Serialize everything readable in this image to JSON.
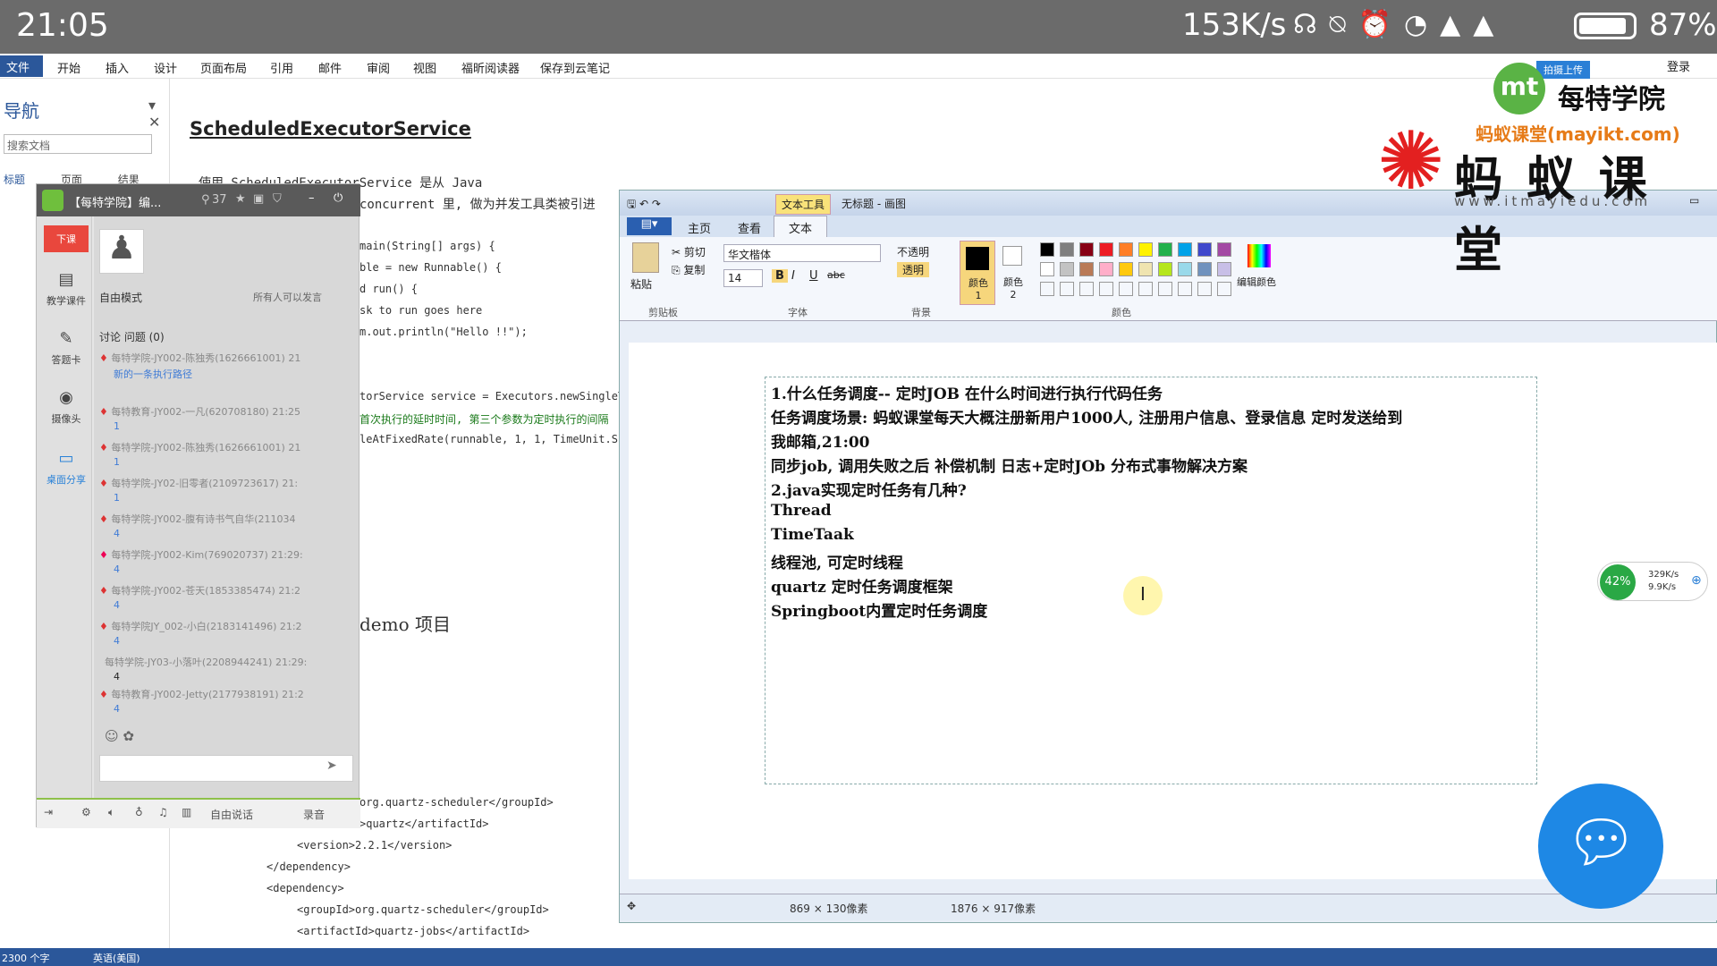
{
  "statusbar": {
    "time": "21:05",
    "speed": "153K/s",
    "battery": "87%"
  },
  "word": {
    "menu": [
      "文件",
      "开始",
      "插入",
      "设计",
      "页面布局",
      "引用",
      "邮件",
      "审阅",
      "视图",
      "福昕阅读器",
      "保存到云笔记"
    ],
    "login": "登录",
    "nav_title": "导航",
    "nav_search": "搜索文档",
    "nav_tabs": [
      "标题",
      "页面",
      "结果"
    ],
    "heading": "ScheduledExecutorService",
    "lines": [
      "使用 ScheduledExecutorService 是从 Java",
      "concurrent 里, 做为并发工具类被引进",
      "main(String[] args) {",
      "ble = new Runnable() {",
      "d run() {",
      "sk to run goes here",
      "m.out.println(\"Hello !!\");",
      "torService service = Executors.newSingleTh",
      "首次执行的延时时间, 第三个参数为定时执行的间隔",
      "leAtFixedRate(runnable, 1, 1, TimeUnit.SEC",
      "demo 项目",
      "org.quartz-scheduler</groupId>",
      ">quartz</artifactId>",
      "<version>2.2.1</version>",
      "</dependency>",
      "<dependency>",
      "<groupId>org.quartz-scheduler</groupId>",
      "<artifactId>quartz-jobs</artifactId>"
    ],
    "status_words": "2300 个字",
    "status_lang": "英语(美国)"
  },
  "classroom": {
    "title": "【每特学院】编...",
    "count": "37",
    "sidebar": [
      "下课",
      "教学课件",
      "答题卡",
      "摄像头",
      "桌面分享"
    ],
    "mode": "自由模式",
    "mode_right": "所有人可以发言",
    "tabs": "讨论  问题 (0)",
    "messages": [
      {
        "name": "每特学院-JY002-陈独秀(1626661001) 21",
        "sub": "新的一条执行路径"
      },
      {
        "name": "每特教育-JY002-一凡(620708180) 21:25",
        "sub": "1"
      },
      {
        "name": "每特学院-JY002-陈独秀(1626661001) 21",
        "sub": "1"
      },
      {
        "name": "每特学院-JY02-旧零者(2109723617) 21:",
        "sub": "1"
      },
      {
        "name": "每特学院-JY002-腹有诗书气自华(211034",
        "sub": "4"
      },
      {
        "name": "每特学院-JY002-Kim(769020737) 21:29:",
        "sub": "4"
      },
      {
        "name": "每特学院-JY002-苍天(1853385474) 21:2",
        "sub": "4"
      },
      {
        "name": "每特学院JY_002-小白(2183141496) 21:2",
        "sub": "4"
      },
      {
        "name": "每特学院-JY03-小落叶(2208944241) 21:29:",
        "sub": "4"
      },
      {
        "name": "每特教育-JY002-Jetty(2177938191) 21:2",
        "sub": "4"
      }
    ],
    "bottom": [
      "自由说话",
      "录音"
    ]
  },
  "paint": {
    "title": "无标题 - 画图",
    "texttool": "文本工具",
    "tabs": [
      "主页",
      "查看",
      "文本"
    ],
    "paste": "粘贴",
    "cut": "剪切",
    "copy": "复制",
    "font": "华文楷体",
    "size": "14",
    "opaque": "不透明",
    "transparent": "透明",
    "color1": "颜色 1",
    "color2": "颜色 2",
    "edit_colors": "编辑颜色",
    "groups": [
      "剪贴板",
      "字体",
      "背景",
      "颜色"
    ],
    "palette": [
      "#000000",
      "#7f7f7f",
      "#880015",
      "#ed1c24",
      "#ff7f27",
      "#fff200",
      "#22b14c",
      "#00a2e8",
      "#3f48cc",
      "#a349a4",
      "#ffffff",
      "#c3c3c3",
      "#b97a57",
      "#ffaec9",
      "#ffc90e",
      "#efe4b0",
      "#b5e61d",
      "#99d9ea",
      "#7092be",
      "#c8bfe7"
    ],
    "text": [
      "1.什么任务调度-- 定时JOB  在什么时间进行执行代码任务",
      "  任务调度场景: 蚂蚁课堂每天大概注册新用户1000人,  注册用户信息、登录信息  定时发送给到",
      "我邮箱,21:00",
      "   同步job, 调用失败之后 补偿机制 日志+定时JOb 分布式事物解决方案",
      "2.java实现定时任务有几种?",
      "   Thread",
      "   TimeTaak",
      "   线程池, 可定时线程",
      "   quartz 定时任务调度框架",
      "   Springboot内置定时任务调度"
    ],
    "status_sel": "869 × 130像素",
    "status_size": "1876 × 917像素"
  },
  "logo": {
    "brand1": "每特学院",
    "brand2": "蚂蚁课堂(mayikt.com)",
    "big": "蚂 蚁 课 堂",
    "url": "www.itmayiedu.com",
    "upload": "拍摄上传"
  },
  "netmon": {
    "pct": "42%",
    "up": "329K/s",
    "down": "9.9K/s"
  }
}
